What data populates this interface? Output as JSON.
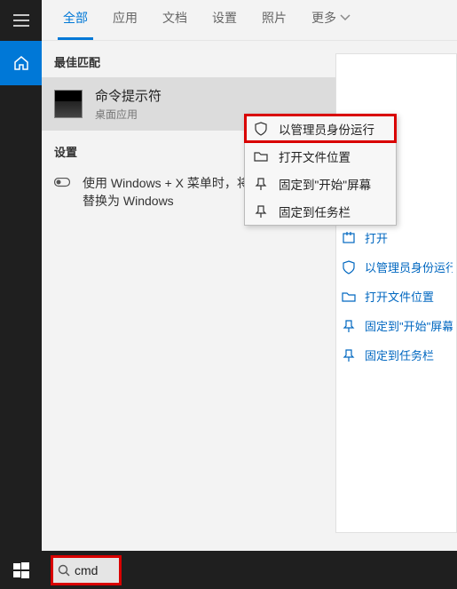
{
  "tabs": {
    "all": "全部",
    "apps": "应用",
    "docs": "文档",
    "settings": "设置",
    "photos": "照片",
    "more": "更多"
  },
  "sections": {
    "best_match": "最佳匹配",
    "settings": "设置"
  },
  "best_match": {
    "title": "命令提示符",
    "subtitle": "桌面应用"
  },
  "settings_item": {
    "text": "使用 Windows + X 菜单时，将命令提示符替换为 Windows"
  },
  "context_menu": {
    "run_admin": "以管理员身份运行",
    "open_location": "打开文件位置",
    "pin_start": "固定到\"开始\"屏幕",
    "pin_taskbar": "固定到任务栏"
  },
  "preview_actions": {
    "open": "打开",
    "run_admin": "以管理员身份运行",
    "open_location": "打开文件位置",
    "pin_start": "固定到\"开始\"屏幕",
    "pin_taskbar": "固定到任务栏"
  },
  "search": {
    "value": "cmd"
  }
}
